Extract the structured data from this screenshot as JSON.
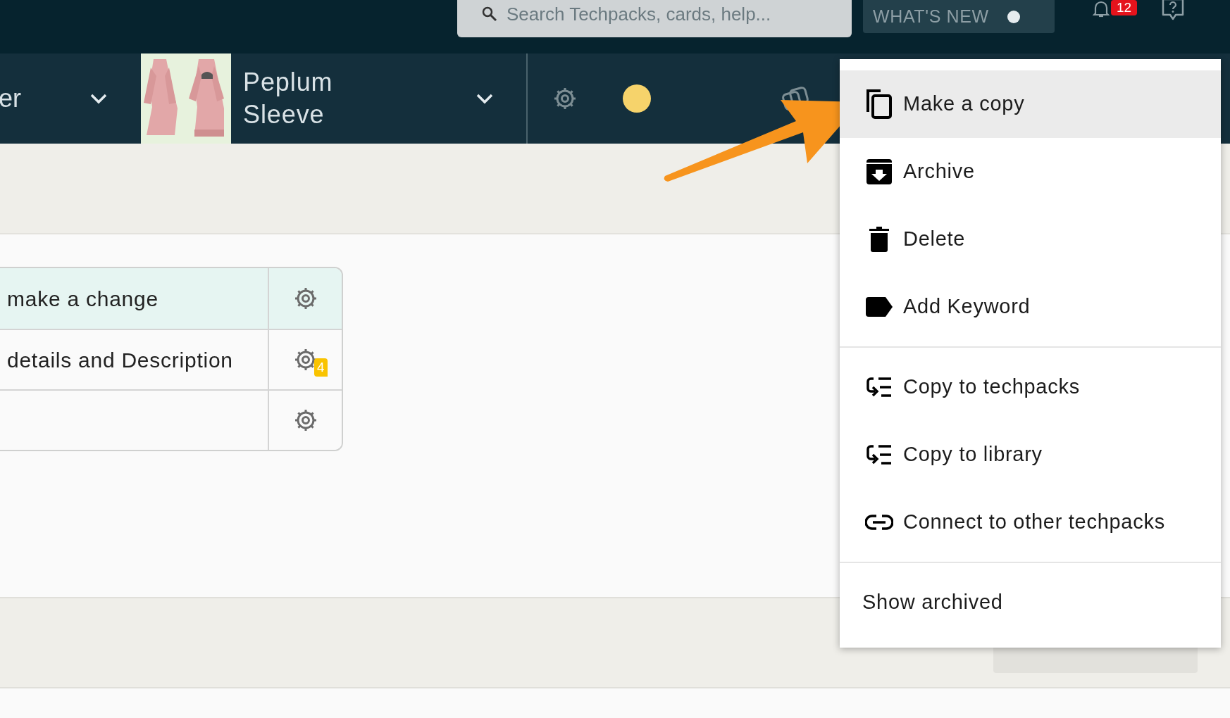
{
  "header": {
    "search": {
      "placeholder": "Search Techpacks, cards, help..."
    },
    "whats_new": "WHAT'S NEW",
    "notification_count": "12"
  },
  "style_bar": {
    "previous_style": "er",
    "style_name": "Peplum Sleeve"
  },
  "table": {
    "rows": [
      {
        "text": "make a change",
        "highlighted": true
      },
      {
        "text": "details and Description",
        "highlighted": false,
        "comment_count": "4"
      },
      {
        "text": "",
        "highlighted": false
      }
    ]
  },
  "menu": {
    "sections": [
      [
        {
          "kind": "copy",
          "label": "Make a copy",
          "selected": true
        },
        {
          "kind": "archive",
          "label": "Archive",
          "selected": false
        },
        {
          "kind": "delete",
          "label": "Delete",
          "selected": false
        },
        {
          "kind": "keyword",
          "label": "Add Keyword",
          "selected": false
        }
      ],
      [
        {
          "kind": "copy-to",
          "label": "Copy to techpacks",
          "selected": false
        },
        {
          "kind": "copy-to",
          "label": "Copy to library",
          "selected": false
        },
        {
          "kind": "link",
          "label": "Connect to other techpacks",
          "selected": false
        }
      ],
      [
        {
          "kind": "text",
          "label": "Show archived",
          "selected": false
        }
      ]
    ]
  }
}
